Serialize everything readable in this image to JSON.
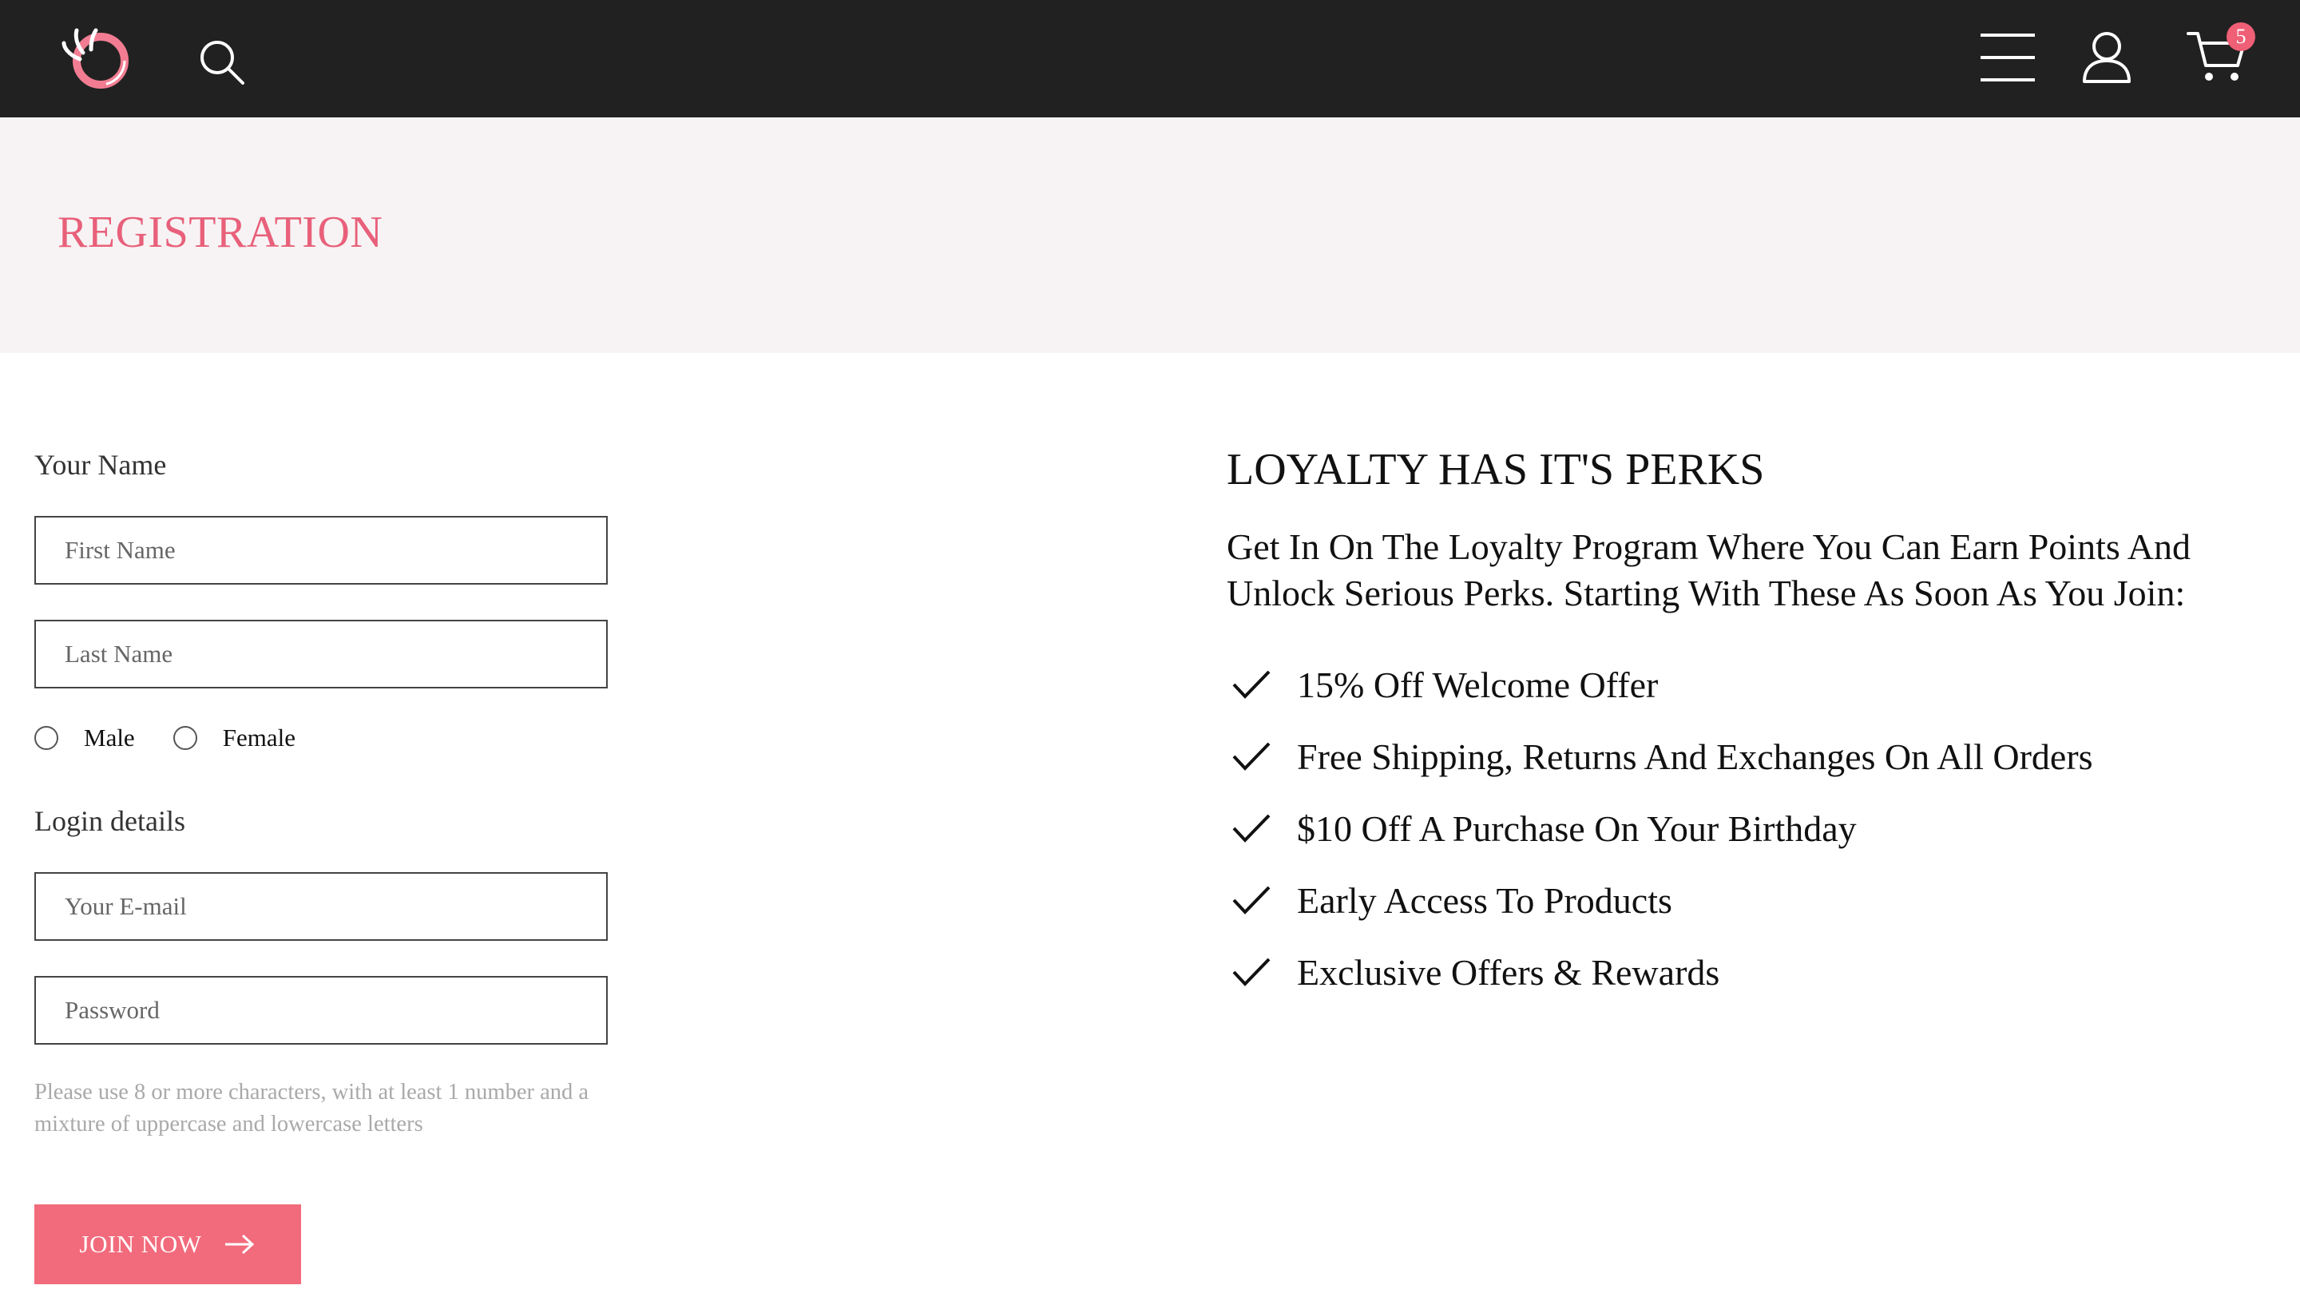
{
  "colors": {
    "accent": "#e8607a",
    "button": "#f26b7c",
    "topbar": "#212121",
    "hero_bg": "#f7f3f4",
    "hint": "#a9a9a9"
  },
  "header": {
    "logo_icon": "brand-logo",
    "icons": [
      "search-icon",
      "menu-icon",
      "user-icon",
      "cart-icon"
    ],
    "cart_count": "5"
  },
  "hero": {
    "title": "REGISTRATION"
  },
  "form": {
    "name_label": "Your Name",
    "first_name_placeholder": "First Name",
    "last_name_placeholder": "Last Name",
    "gender_options": [
      "Male",
      "Female"
    ],
    "login_label": "Login details",
    "email_placeholder": "Your E-mail",
    "password_placeholder": "Password",
    "password_hint": "Please use 8 or more characters, with at least 1 number and a mixture of uppercase and lowercase letters",
    "submit_label": "JOIN NOW"
  },
  "perks": {
    "title": "LOYALTY HAS IT'S PERKS",
    "intro": "Get In On The Loyalty Program Where You Can Earn Points And Unlock Serious Perks. Starting With These As Soon As You Join:",
    "items": [
      "15% Off Welcome Offer",
      "Free Shipping, Returns And Exchanges On All Orders",
      "$10 Off A Purchase On Your Birthday",
      "Early Access To Products",
      "Exclusive Offers & Rewards"
    ]
  }
}
